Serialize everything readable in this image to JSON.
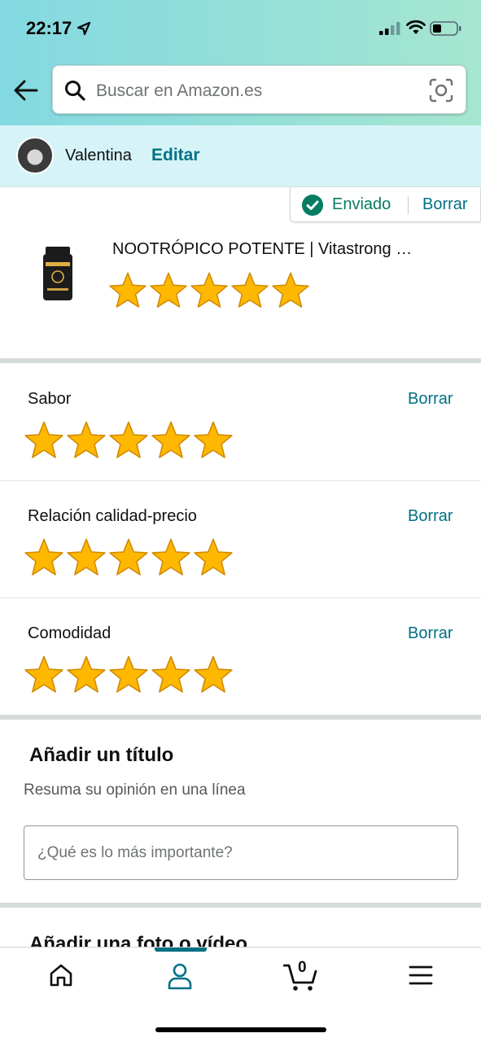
{
  "status_bar": {
    "time": "22:17"
  },
  "search": {
    "placeholder": "Buscar en Amazon.es"
  },
  "user": {
    "name": "Valentina",
    "edit_label": "Editar"
  },
  "sent_badge": {
    "label": "Enviado",
    "delete_label": "Borrar"
  },
  "product": {
    "title": "NOOTRÓPICO POTENTE | Vitastrong …",
    "rating": 5,
    "rating_max": 5
  },
  "attributes": [
    {
      "label": "Sabor",
      "delete_label": "Borrar",
      "rating": 5
    },
    {
      "label": "Relación calidad-precio",
      "delete_label": "Borrar",
      "rating": 5
    },
    {
      "label": "Comodidad",
      "delete_label": "Borrar",
      "rating": 5
    }
  ],
  "title_section": {
    "heading": "Añadir un título",
    "subheading": "Resuma su opinión en una línea",
    "input_placeholder": "¿Qué es lo más importante?"
  },
  "photo_section": {
    "heading": "Añadir una foto o vídeo"
  },
  "tabbar": {
    "tabs": [
      {
        "icon": "home-icon"
      },
      {
        "icon": "account-icon",
        "active": true
      },
      {
        "icon": "cart-icon"
      },
      {
        "icon": "menu-icon"
      }
    ],
    "cart_count": "0"
  },
  "colors": {
    "link": "#007185",
    "success": "#067d62",
    "star_fill": "#ffb800",
    "star_stroke": "#d18a00"
  }
}
